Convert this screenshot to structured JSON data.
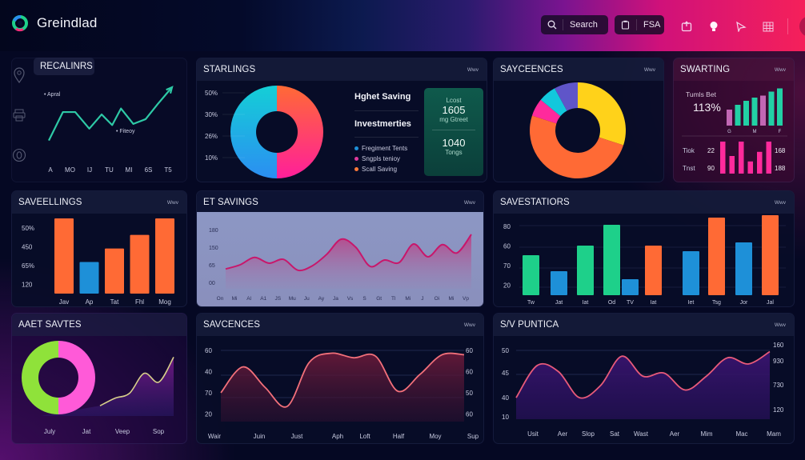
{
  "app": {
    "name": "Greindlad",
    "search_label": "Search",
    "fsa_label": "FSA",
    "top_icons": [
      "export-icon",
      "lightbulb-icon",
      "send-icon",
      "grid-icon"
    ],
    "avatar_icon": "bar-chart-icon"
  },
  "sidebar": {
    "icons": [
      "location-pin-icon",
      "printer-icon",
      "circle-zero-icon"
    ]
  },
  "colors": {
    "accent_teal": "#2ec9a6",
    "orange": "#ff6a35",
    "blue": "#1e90d8",
    "green": "#1ed08a",
    "pink": "#ff2a9c",
    "yellow": "#ffd21a",
    "cyan": "#12c8dc",
    "indigo": "#5f55c9",
    "lime": "#8fe23a",
    "violet_bar": "#c267b4"
  },
  "panels": {
    "recalinrs": {
      "title": "RECALINRS",
      "annotation_top": "• Apral",
      "annotation_mid": "• Fiteoy"
    },
    "starlings": {
      "title": "STARLINGS",
      "view": "Wwv",
      "stat1": "Hghet Saving",
      "stat2": "Investmerties",
      "legend": [
        {
          "label": "Fregiment Tents",
          "color": "#1e90d8"
        },
        {
          "label": "Sngpls tenioy",
          "color": "#e0399c"
        },
        {
          "label": "Scall Saving",
          "color": "#ff7a3a"
        }
      ],
      "card": {
        "k1": "Lcost",
        "v1": "1605",
        "k2": "mg Gtreet",
        "v2": "1040",
        "k3": "Tongs"
      }
    },
    "sayceences": {
      "title": "SAYCEENCES",
      "view": "Wwv"
    },
    "swarting": {
      "title": "SWARTING",
      "view": "Wwv",
      "kpi_label": "Tumls Bet",
      "kpi_value": "113%",
      "row1_label": "Tiok",
      "row1_value": "22",
      "row1_right": "168",
      "row2_label": "Tnst",
      "row2_value": "90",
      "row2_right": "188"
    },
    "saveellings": {
      "title": "SAVEELLINGS",
      "view": "Wwv"
    },
    "et_savings": {
      "title": "ET SAVINGS",
      "view": "Wwv"
    },
    "savestatiors": {
      "title": "SAVESTATIORS",
      "view": "Wwv"
    },
    "aast_savtes": {
      "title": "AAET SAVTES"
    },
    "savcences": {
      "title": "SAVCENCES",
      "view": "Wwv"
    },
    "sv_puntica": {
      "title": "S/V PUNTICA",
      "view": "Wwv"
    }
  },
  "chart_data": [
    {
      "id": "recalinrs",
      "type": "line",
      "title": "RECALINRS",
      "categories": [
        "A",
        "MO",
        "IJ",
        "TU",
        "MI",
        "6S",
        "T5"
      ],
      "x": [
        0,
        0.8,
        1.5,
        2.3,
        3.0,
        3.6,
        4.1,
        4.8,
        5.5,
        6.2,
        7.0
      ],
      "values": [
        10,
        58,
        58,
        30,
        54,
        36,
        64,
        38,
        46,
        72,
        100
      ],
      "ylim": [
        0,
        100
      ]
    },
    {
      "id": "starlings",
      "type": "pie",
      "title": "STARLINGS",
      "ytick_labels": [
        "50%",
        "30%",
        "26%",
        "10%"
      ],
      "slices": [
        {
          "label": "Orange-Pink",
          "value": 50,
          "colors": [
            "#ff6a35",
            "#ff1f9a"
          ]
        },
        {
          "label": "Cyan-Blue",
          "value": 50,
          "colors": [
            "#1ac6d8",
            "#2a8ef0"
          ]
        }
      ],
      "donut": true
    },
    {
      "id": "sayceences",
      "type": "pie",
      "title": "SAYCEENCES",
      "slices": [
        {
          "label": "Yellow",
          "value": 30,
          "color": "#ffd21a"
        },
        {
          "label": "Orange",
          "value": 50,
          "color": "#ff6a35"
        },
        {
          "label": "Pink",
          "value": 6,
          "color": "#ff2a9c"
        },
        {
          "label": "Cyan",
          "value": 6,
          "color": "#12c8dc"
        },
        {
          "label": "Indigo",
          "value": 8,
          "color": "#5f55c9"
        }
      ],
      "donut": true
    },
    {
      "id": "swarting_top",
      "type": "bar",
      "categories": [
        "G",
        "",
        "M",
        "",
        "",
        "",
        "F"
      ],
      "xtick_labels": [
        "G",
        "M",
        "F"
      ],
      "values": [
        40,
        52,
        62,
        70,
        75,
        85,
        93
      ],
      "colors": [
        "#c267b4",
        "#22d0a5",
        "#22d0a5",
        "#22d0a5",
        "#c267b4",
        "#22d0a5",
        "#22d0a5"
      ],
      "ylim": [
        0,
        100
      ]
    },
    {
      "id": "swarting_bottom",
      "type": "bar",
      "values": [
        100,
        55,
        100,
        38,
        68,
        100
      ],
      "color": "#ff2a9c",
      "ylim": [
        0,
        100
      ]
    },
    {
      "id": "saveellings",
      "type": "bar",
      "title": "SAVEELLINGS",
      "categories": [
        "Jav",
        "Ap",
        "Tat",
        "Fhl",
        "Mog"
      ],
      "values": [
        100,
        42,
        60,
        78,
        100
      ],
      "colors": [
        "#ff6a35",
        "#1e90d8",
        "#ff6a35",
        "#ff6a35",
        "#ff6a35"
      ],
      "ytick_labels": [
        "50%",
        "450",
        "65%",
        "120"
      ],
      "ylim": [
        0,
        100
      ]
    },
    {
      "id": "et_savings",
      "type": "area",
      "title": "ET SAVINGS",
      "categories": [
        "On",
        "Mi",
        "Al",
        "A1",
        "JS",
        "Mu",
        "Ju",
        "Ay",
        "Ja",
        "Vs",
        "S",
        "Gt",
        "Tl",
        "Mi",
        "J",
        "Oi",
        "Mi",
        "Vp"
      ],
      "values": [
        62,
        75,
        98,
        80,
        92,
        58,
        72,
        108,
        155,
        130,
        70,
        90,
        82,
        140,
        100,
        138,
        112,
        170
      ],
      "ytick_labels": [
        "180",
        "150",
        "65",
        "00"
      ],
      "ylim": [
        0,
        200
      ]
    },
    {
      "id": "savestatiors",
      "type": "bar",
      "title": "SAVESTATIORS",
      "categories": [
        "Tw",
        "Jat",
        "Iat",
        "Od",
        "TV",
        "Iat",
        "Iet",
        "Tsg",
        "Jor",
        "Jal"
      ],
      "values": [
        50,
        30,
        62,
        88,
        20,
        62,
        55,
        97,
        66,
        100
      ],
      "colors": [
        "#1ed08a",
        "#1e90d8",
        "#1ed08a",
        "#1ed08a",
        "#1e90d8",
        "#ff6a35",
        "#1e90d8",
        "#ff6a35",
        "#1e90d8",
        "#ff6a35"
      ],
      "ytick_labels": [
        "80",
        "60",
        "70",
        "20"
      ],
      "ylim": [
        0,
        100
      ]
    },
    {
      "id": "aast_savtes",
      "type": "area",
      "title": "AAET SAVTES",
      "categories": [
        "July",
        "Jat",
        "Veep",
        "Sop"
      ],
      "donut_slices": [
        {
          "label": "Lime",
          "value": 50,
          "color": "#8fe23a"
        },
        {
          "label": "Pink",
          "value": 50,
          "color": "#ff5ad8"
        }
      ],
      "values": [
        10,
        22,
        30,
        62,
        48,
        88
      ],
      "ylim": [
        0,
        100
      ]
    },
    {
      "id": "savcences",
      "type": "area",
      "title": "SAVCENCES",
      "categories": [
        "Wair",
        "Juin",
        "Just",
        "Aph",
        "Loft",
        "Half",
        "Moy",
        "Sup"
      ],
      "values": [
        38,
        72,
        45,
        20,
        78,
        90,
        84,
        86,
        40,
        62,
        88,
        88
      ],
      "ytick_labels_left": [
        "60",
        "40",
        "70",
        "20"
      ],
      "ytick_labels_right": [
        "60",
        "60",
        "50",
        "60"
      ],
      "ylim": [
        0,
        100
      ]
    },
    {
      "id": "sv_puntica",
      "type": "area",
      "title": "S/V PUNTICA",
      "categories": [
        "Usit",
        "Aer",
        "Slop",
        "Sat",
        "Wast",
        "Aer",
        "Mim",
        "Mac",
        "Mam"
      ],
      "values": [
        28,
        70,
        62,
        28,
        44,
        82,
        56,
        60,
        38,
        56,
        80,
        72,
        88
      ],
      "ytick_labels_left": [
        "50",
        "45",
        "40",
        "10"
      ],
      "ytick_labels_right": [
        "160",
        "930",
        "730",
        "120"
      ],
      "ylim": [
        0,
        100
      ]
    }
  ]
}
